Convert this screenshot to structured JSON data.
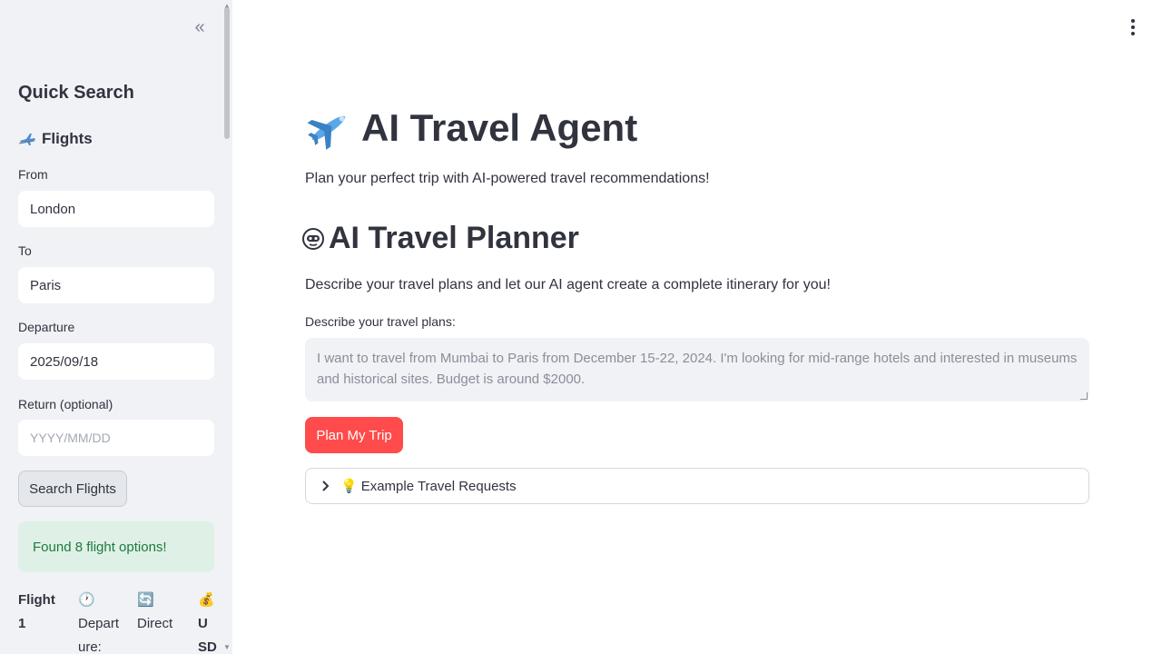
{
  "sidebar": {
    "collapse_icon": "double-chevron-left-icon",
    "title": "Quick Search",
    "flights_heading": "Flights",
    "from_label": "From",
    "from_value": "London",
    "to_label": "To",
    "to_value": "Paris",
    "departure_label": "Departure",
    "departure_value": "2025/09/18",
    "return_label": "Return (optional)",
    "return_placeholder": "YYYY/MM/DD",
    "search_button": "Search Flights",
    "success_message": "Found 8 flight options!",
    "flight_card": {
      "col1_line1": "Flight",
      "col1_line2": "1",
      "col2_icon": "🕐",
      "col2_line1": "Depart",
      "col2_line2": "ure:",
      "col3_icon": "🔄",
      "col3_line1": "Direct",
      "col4_icon": "💰",
      "col4_line1": "U",
      "col4_line2": "SD"
    }
  },
  "main": {
    "title": "AI Travel Agent",
    "subtitle": "Plan your perfect trip with AI-powered travel recommendations!",
    "planner_heading": "AI Travel Planner",
    "planner_desc": "Describe your travel plans and let our AI agent create a complete itinerary for you!",
    "textarea_label": "Describe your travel plans:",
    "textarea_placeholder": "I want to travel from Mumbai to Paris from December 15-22, 2024. I'm looking for mid-range hotels and interested in museums and historical sites. Budget is around $2000.",
    "plan_button": "Plan My Trip",
    "expander_icon": "💡",
    "expander_label": "Example Travel Requests"
  },
  "colors": {
    "primary": "#ff4b4b",
    "sidebar_bg": "#f0f2f6",
    "success_bg": "#dff1e6",
    "success_text": "#1d7a3f",
    "text": "#31333f"
  }
}
